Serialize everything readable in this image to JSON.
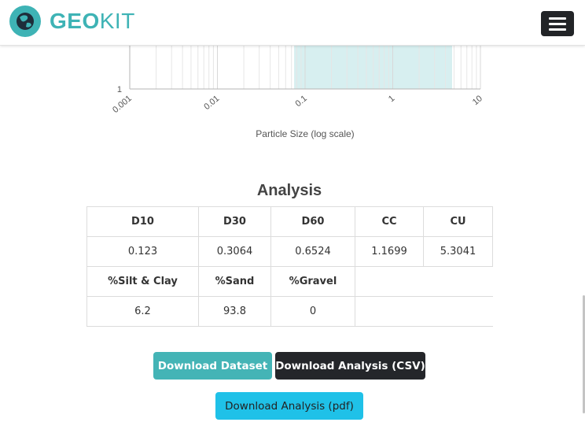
{
  "header": {
    "brand_bold": "GEO",
    "brand_light": "KIT",
    "brand_color": "#3eb3b5",
    "logo_icon": "globe-icon",
    "menu_icon": "hamburger-menu-icon"
  },
  "chart_data": {
    "type": "area",
    "x_scale": "log",
    "xlabel": "Particle Size (log scale)",
    "xlim": [
      0.001,
      10
    ],
    "x_ticks": [
      0.001,
      0.01,
      0.1,
      1,
      10
    ],
    "x_tick_labels": [
      "0.001",
      "0.01",
      "0.1",
      "1",
      "10"
    ],
    "y_ticks": [
      1
    ],
    "y_tick_labels": [
      "1"
    ],
    "grid": true,
    "shaded_band": {
      "from": 0.075,
      "to": 4.75,
      "color": "#d7eff0"
    }
  },
  "analysis": {
    "title": "Analysis",
    "row1_headers": [
      "D10",
      "D30",
      "D60",
      "CC",
      "CU"
    ],
    "row1_values": [
      "0.123",
      "0.3064",
      "0.6524",
      "1.1699",
      "5.3041"
    ],
    "row2_headers": [
      "%Silt & Clay",
      "%Sand",
      "%Gravel"
    ],
    "row2_values": [
      "6.2",
      "93.8",
      "0"
    ]
  },
  "buttons": {
    "download_dataset": "Download Dataset",
    "download_csv": "Download Analysis (CSV)",
    "download_pdf": "Download Analysis (pdf)",
    "colors": {
      "dataset": "#44b4b6",
      "csv": "#24262a",
      "pdf": "#1fc1e8"
    }
  }
}
